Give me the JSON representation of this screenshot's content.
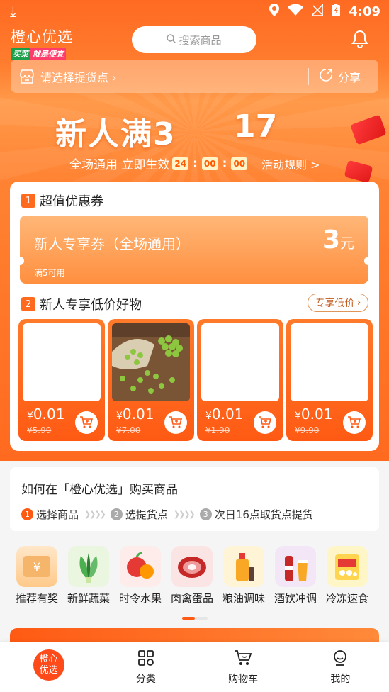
{
  "status_bar": {
    "time": "4:09"
  },
  "header": {
    "app_name": "橙心优选",
    "slogan_part1": "买菜",
    "slogan_part2": "就是便宜",
    "search_placeholder": "搜索商品"
  },
  "pickup": {
    "label": "请选择提货点 ›",
    "share_label": "分享"
  },
  "promo": {
    "headline": "新人满3",
    "headline_num": "17",
    "subtitle": "全场通用 立即生效",
    "countdown": {
      "hours": "24",
      "minutes": "00",
      "seconds": "00"
    },
    "rules_link": "活动规则 >"
  },
  "coupon_section": {
    "index": "1",
    "title": "超值优惠券",
    "coupon_name": "新人专享券（全场通用）",
    "coupon_value": "3",
    "coupon_unit": "元",
    "coupon_condition": "满5可用"
  },
  "products_section": {
    "index": "2",
    "title": "新人专享低价好物",
    "more_button": "专享低价",
    "products": [
      {
        "price": "0.01",
        "original_price": "¥5.99"
      },
      {
        "price": "0.01",
        "original_price": "¥7.00"
      },
      {
        "price": "0.01",
        "original_price": "¥1.90"
      },
      {
        "price": "0.01",
        "original_price": "¥9.90"
      }
    ],
    "currency": "¥"
  },
  "howto": {
    "title": "如何在「橙心优选」购买商品",
    "steps": [
      {
        "num": "1",
        "label": "选择商品"
      },
      {
        "num": "2",
        "label": "选提货点"
      },
      {
        "num": "3",
        "label": "次日16点取货点提货"
      }
    ]
  },
  "categories": [
    {
      "label": "推荐有奖"
    },
    {
      "label": "新鲜蔬菜"
    },
    {
      "label": "时令水果"
    },
    {
      "label": "肉禽蛋品"
    },
    {
      "label": "粮油调味"
    },
    {
      "label": "酒饮冲调"
    },
    {
      "label": "冷冻速食"
    }
  ],
  "bottom_nav": {
    "home": "橙心\n优选",
    "category": "分类",
    "cart": "购物车",
    "me": "我的"
  },
  "colors": {
    "accent": "#ff6a1f",
    "brand_green": "#1aa04a"
  }
}
